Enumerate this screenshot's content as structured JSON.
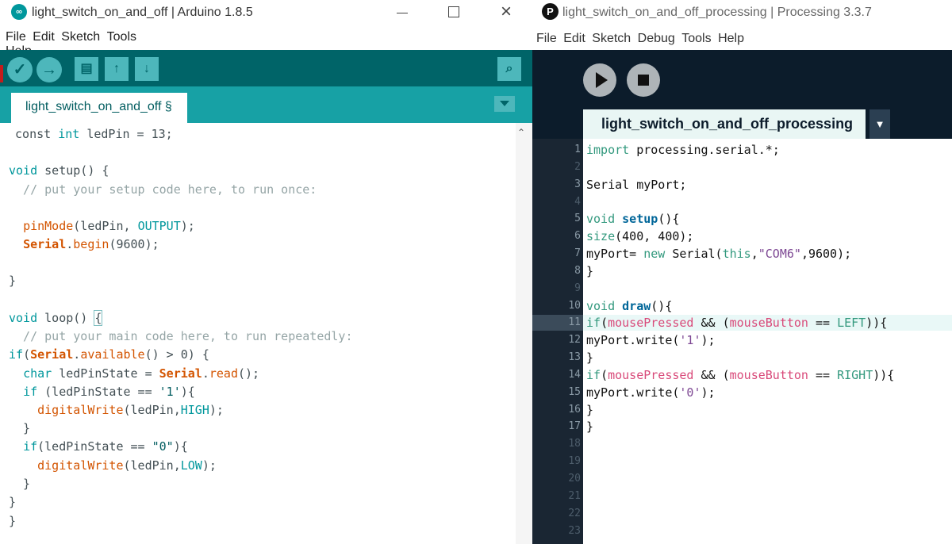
{
  "arduino": {
    "window_title": "light_switch_on_and_off | Arduino 1.8.5",
    "menu": [
      "File",
      "Edit",
      "Sketch",
      "Tools",
      "Help"
    ],
    "toolbar_icons": [
      "verify-icon",
      "upload-icon",
      "new-icon",
      "open-icon",
      "save-icon",
      "serial-monitor-icon"
    ],
    "tab_label": "light_switch_on_and_off §",
    "code": {
      "l1a": " const ",
      "l1b": "int",
      "l1c": " ledPin = 13;",
      "l2a": "void",
      "l2b": " setup() {",
      "l3": "  // put your setup code here, to run once:",
      "l4a": "  ",
      "l4b": "pinMode",
      "l4c": "(ledPin, ",
      "l4d": "OUTPUT",
      "l4e": ");",
      "l5a": "  ",
      "l5b": "Serial",
      "l5c": ".",
      "l5d": "begin",
      "l5e": "(9600);",
      "l6": "}",
      "l7a": "void",
      "l7b": " loop() ",
      "l7c": "{",
      "l8": "  // put your main code here, to run repeatedly:",
      "l9a": "if",
      "l9b": "(",
      "l9c": "Serial",
      "l9d": ".",
      "l9e": "available",
      "l9f": "() > 0) {",
      "l10a": "  ",
      "l10b": "char",
      "l10c": " ledPinState = ",
      "l10d": "Serial",
      "l10e": ".",
      "l10f": "read",
      "l10g": "();",
      "l11a": "  ",
      "l11b": "if",
      "l11c": " (ledPinState == ",
      "l11d": "'1'",
      "l11e": "){",
      "l12a": "    ",
      "l12b": "digitalWrite",
      "l12c": "(ledPin,",
      "l12d": "HIGH",
      "l12e": ");",
      "l13": "  }",
      "l14a": "  ",
      "l14b": "if",
      "l14c": "(ledPinState == ",
      "l14d": "\"0\"",
      "l14e": "){",
      "l15a": "    ",
      "l15b": "digitalWrite",
      "l15c": "(ledPin,",
      "l15d": "LOW",
      "l15e": ");",
      "l16": "  }",
      "l17": "}",
      "l18": "}"
    }
  },
  "processing": {
    "window_title": "light_switch_on_and_off_processing | Processing 3.3.7",
    "menu": [
      "File",
      "Edit",
      "Sketch",
      "Debug",
      "Tools",
      "Help"
    ],
    "tab_label": "light_switch_on_and_off_processing",
    "tab_menu_glyph": "▼",
    "line_numbers": [
      "1",
      "2",
      "3",
      "4",
      "5",
      "6",
      "7",
      "8",
      "9",
      "10",
      "11",
      "12",
      "13",
      "14",
      "15",
      "16",
      "17",
      "18",
      "19",
      "20",
      "21",
      "22",
      "23"
    ],
    "code": {
      "l1a": "import",
      "l1b": " processing.serial.*;",
      "l3": "Serial myPort;",
      "l5a": "void",
      "l5b": " ",
      "l5c": "setup",
      "l5d": "(){",
      "l6a": "size",
      "l6b": "(400, 400);",
      "l7a": "myPort= ",
      "l7b": "new",
      "l7c": " Serial(",
      "l7d": "this",
      "l7e": ",",
      "l7f": "\"COM6\"",
      "l7g": ",9600);",
      "l8": "}",
      "l10a": "void",
      "l10b": " ",
      "l10c": "draw",
      "l10d": "(){",
      "l11a": "if",
      "l11b": "(",
      "l11c": "mousePressed",
      "l11d": " && (",
      "l11e": "mouseButton",
      "l11f": " == ",
      "l11g": "LEFT",
      "l11h": ")){",
      "l12a": "myPort.write(",
      "l12b": "'1'",
      "l12c": ");",
      "l13": "}",
      "l14a": "if",
      "l14b": "(",
      "l14c": "mousePressed",
      "l14d": " && (",
      "l14e": "mouseButton",
      "l14f": " == ",
      "l14g": "RIGHT",
      "l14h": ")){",
      "l15a": "myPort.write(",
      "l15b": "'0'",
      "l15c": ");",
      "l16": "}",
      "l17": "}"
    }
  }
}
